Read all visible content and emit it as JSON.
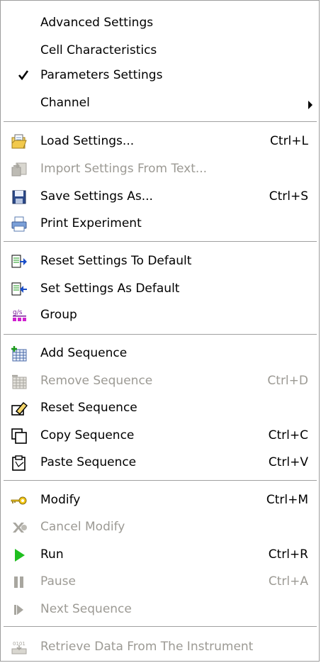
{
  "menu": {
    "items": [
      {
        "label": "Advanced Settings",
        "shortcut": "",
        "enabled": true
      },
      {
        "label": "Cell Characteristics",
        "shortcut": "",
        "enabled": true
      },
      {
        "label": "Parameters Settings",
        "shortcut": "",
        "enabled": true,
        "checked": true
      },
      {
        "label": "Channel",
        "shortcut": "",
        "enabled": true,
        "submenu": true
      },
      {
        "label": "Load Settings...",
        "shortcut": "Ctrl+L",
        "enabled": true,
        "icon": "folder-open-icon"
      },
      {
        "label": "Import Settings From Text...",
        "shortcut": "",
        "enabled": false,
        "icon": "import-icon"
      },
      {
        "label": "Save Settings As...",
        "shortcut": "Ctrl+S",
        "enabled": true,
        "icon": "floppy-disk-icon"
      },
      {
        "label": "Print Experiment",
        "shortcut": "",
        "enabled": true,
        "icon": "printer-icon"
      },
      {
        "label": "Reset Settings To Default",
        "shortcut": "",
        "enabled": true,
        "icon": "reset-default-icon"
      },
      {
        "label": "Set Settings As Default",
        "shortcut": "",
        "enabled": true,
        "icon": "set-default-icon"
      },
      {
        "label": "Group",
        "shortcut": "",
        "enabled": true,
        "icon": "group-icon"
      },
      {
        "label": "Add Sequence",
        "shortcut": "",
        "enabled": true,
        "icon": "add-grid-icon"
      },
      {
        "label": "Remove Sequence",
        "shortcut": "Ctrl+D",
        "enabled": false,
        "icon": "remove-grid-icon"
      },
      {
        "label": "Reset Sequence",
        "shortcut": "",
        "enabled": true,
        "icon": "eraser-icon"
      },
      {
        "label": "Copy Sequence",
        "shortcut": "Ctrl+C",
        "enabled": true,
        "icon": "copy-icon"
      },
      {
        "label": "Paste Sequence",
        "shortcut": "Ctrl+V",
        "enabled": true,
        "icon": "paste-icon"
      },
      {
        "label": "Modify",
        "shortcut": "Ctrl+M",
        "enabled": true,
        "icon": "key-icon"
      },
      {
        "label": "Cancel Modify",
        "shortcut": "",
        "enabled": false,
        "icon": "cancel-modify-icon"
      },
      {
        "label": "Run",
        "shortcut": "Ctrl+R",
        "enabled": true,
        "icon": "play-icon"
      },
      {
        "label": "Pause",
        "shortcut": "Ctrl+A",
        "enabled": false,
        "icon": "pause-icon"
      },
      {
        "label": "Next Sequence",
        "shortcut": "",
        "enabled": false,
        "icon": "next-sequence-icon"
      },
      {
        "label": "Retrieve Data From The Instrument",
        "shortcut": "",
        "enabled": false,
        "icon": "retrieve-data-icon"
      }
    ]
  },
  "colors": {
    "disabled_text": "#9c9a94",
    "separator": "#a0a0a0",
    "run_green": "#1fbf1f"
  }
}
